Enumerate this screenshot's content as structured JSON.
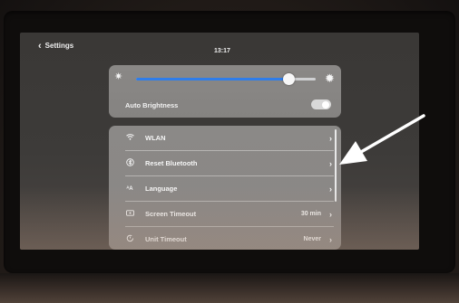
{
  "header": {
    "back_label": "Settings",
    "time": "13:17"
  },
  "brightness": {
    "level_fraction": 0.85,
    "auto_label": "Auto Brightness",
    "auto_enabled": true
  },
  "settings_list": [
    {
      "icon": "wifi-icon",
      "label": "WLAN",
      "value": ""
    },
    {
      "icon": "bluetooth-icon",
      "label": "Reset Bluetooth",
      "value": ""
    },
    {
      "icon": "language-icon",
      "label": "Language",
      "value": ""
    },
    {
      "icon": "screen-icon",
      "label": "Screen Timeout",
      "value": "30 min"
    },
    {
      "icon": "timer-icon",
      "label": "Unit Timeout",
      "value": "Never"
    }
  ],
  "colors": {
    "slider_fill": "#2f7de9",
    "card_bg": "#888684",
    "annotation_arrow": "#ffffff"
  }
}
